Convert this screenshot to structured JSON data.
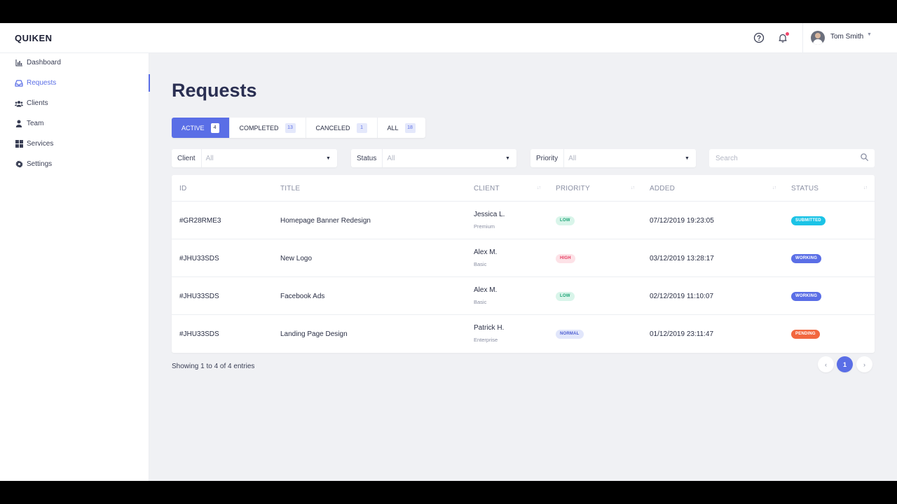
{
  "app": {
    "logo": "QUIKEN"
  },
  "header": {
    "icons": [
      "help-icon",
      "bell-icon"
    ],
    "user_name": "Tom Smith"
  },
  "sidebar": {
    "items": [
      {
        "label": "Dashboard",
        "icon": "chart-bar-icon",
        "active": false
      },
      {
        "label": "Requests",
        "icon": "inbox-icon",
        "active": true
      },
      {
        "label": "Clients",
        "icon": "users-icon",
        "active": false
      },
      {
        "label": "Team",
        "icon": "user-icon",
        "active": false
      },
      {
        "label": "Services",
        "icon": "grid-icon",
        "active": false
      },
      {
        "label": "Settings",
        "icon": "gear-icon",
        "active": false
      }
    ]
  },
  "page": {
    "title": "Requests"
  },
  "tabs": [
    {
      "label": "ACTIVE",
      "count": "4",
      "active": true
    },
    {
      "label": "COMPLETED",
      "count": "13",
      "active": false
    },
    {
      "label": "CANCELED",
      "count": "1",
      "active": false
    },
    {
      "label": "ALL",
      "count": "18",
      "active": false
    }
  ],
  "filters": {
    "client": {
      "label": "Client",
      "value": "All"
    },
    "status": {
      "label": "Status",
      "value": "All"
    },
    "priority": {
      "label": "Priority",
      "value": "All"
    },
    "search": {
      "placeholder": "Search"
    }
  },
  "table": {
    "headers": {
      "id": "ID",
      "title": "TITLE",
      "client": "CLIENT",
      "priority": "PRIORITY",
      "added": "ADDED",
      "status": "STATUS"
    },
    "rows": [
      {
        "id": "#GR28RME3",
        "title": "Homepage Banner Redesign",
        "client": "Jessica L.",
        "plan": "Premium",
        "priority": "LOW",
        "added": "07/12/2019 19:23:05",
        "status": "SUBMITTED"
      },
      {
        "id": "#JHU33SDS",
        "title": "New Logo",
        "client": "Alex M.",
        "plan": "Basic",
        "priority": "HIGH",
        "added": "03/12/2019 13:28:17",
        "status": "WORKING"
      },
      {
        "id": "#JHU33SDS",
        "title": "Facebook Ads",
        "client": "Alex M.",
        "plan": "Basic",
        "priority": "LOW",
        "added": "02/12/2019 11:10:07",
        "status": "WORKING"
      },
      {
        "id": "#JHU33SDS",
        "title": "Landing Page Design",
        "client": "Patrick H.",
        "plan": "Enterprise",
        "priority": "NORMAL",
        "added": "01/12/2019 23:11:47",
        "status": "PENDING"
      }
    ]
  },
  "badge_colors": {
    "LOW": {
      "bg": "#d9f5ea",
      "fg": "#1aa274"
    },
    "HIGH": {
      "bg": "#fde2e7",
      "fg": "#e53a5e"
    },
    "NORMAL": {
      "bg": "#e1e6fb",
      "fg": "#4a5bd0"
    },
    "SUBMITTED": {
      "bg": "#1bc3e6",
      "fg": "#ffffff"
    },
    "WORKING": {
      "bg": "#5a6ee6",
      "fg": "#ffffff"
    },
    "PENDING": {
      "bg": "#f2673f",
      "fg": "#ffffff"
    }
  },
  "footer": {
    "showing": "Showing 1 to 4 of 4 entries",
    "current_page": "1"
  }
}
